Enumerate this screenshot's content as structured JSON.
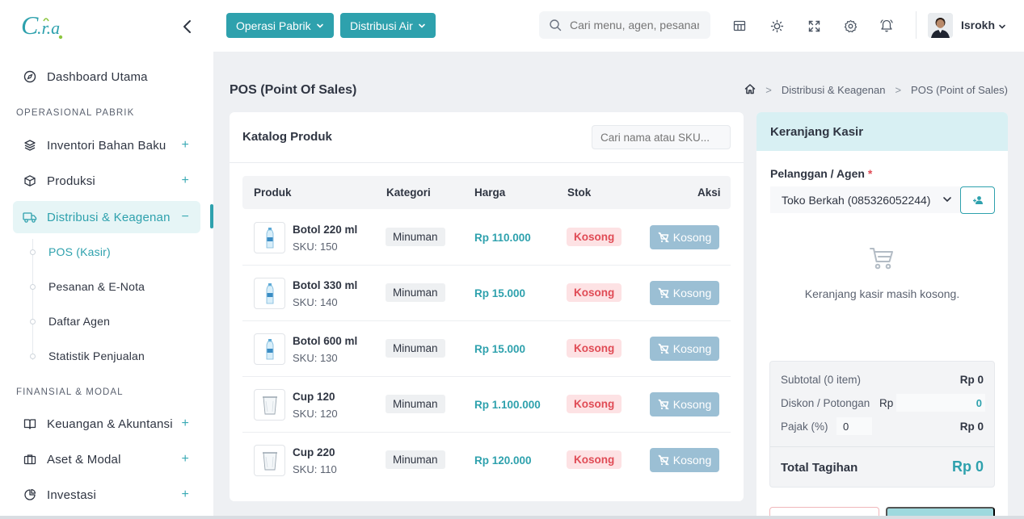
{
  "logo": {
    "text": "C.r.a."
  },
  "sidebar": {
    "dashboard": "Dashboard Utama",
    "section_operasional": "OPERASIONAL PABRIK",
    "inventori": "Inventori Bahan Baku",
    "produksi": "Produksi",
    "distribusi": "Distribusi & Keagenan",
    "sub_pos": "POS (Kasir)",
    "sub_pesanan": "Pesanan & E-Nota",
    "sub_agen": "Daftar Agen",
    "sub_statistik": "Statistik Penjualan",
    "section_finansial": "FINANSIAL & MODAL",
    "keuangan": "Keuangan & Akuntansi",
    "aset": "Aset & Modal",
    "investasi": "Investasi",
    "plus": "+",
    "minus": "−"
  },
  "topbar": {
    "btn_operasi": "Operasi Pabrik",
    "btn_distribusi": "Distribusi Air",
    "search_placeholder": "Cari menu, agen, pesanan...",
    "user_name": "Isrokh"
  },
  "page": {
    "title": "POS (Point Of Sales)",
    "breadcrumb_1": "Distribusi & Keagenan",
    "breadcrumb_2": "POS (Point of Sales)",
    "breadcrumb_sep": ">"
  },
  "catalog": {
    "title": "Katalog Produk",
    "search_placeholder": "Cari nama atau SKU...",
    "headers": {
      "produk": "Produk",
      "kategori": "Kategori",
      "harga": "Harga",
      "stok": "Stok",
      "aksi": "Aksi"
    },
    "rows": [
      {
        "name": "Botol 220 ml",
        "sku": "SKU: 150",
        "category": "Minuman",
        "price": "Rp 110.000",
        "stock": "Kosong",
        "action": "Kosong"
      },
      {
        "name": "Botol 330 ml",
        "sku": "SKU: 140",
        "category": "Minuman",
        "price": "Rp 15.000",
        "stock": "Kosong",
        "action": "Kosong"
      },
      {
        "name": "Botol 600 ml",
        "sku": "SKU: 130",
        "category": "Minuman",
        "price": "Rp 15.000",
        "stock": "Kosong",
        "action": "Kosong"
      },
      {
        "name": "Cup 120",
        "sku": "SKU: 120",
        "category": "Minuman",
        "price": "Rp 1.100.000",
        "stock": "Kosong",
        "action": "Kosong"
      },
      {
        "name": "Cup 220",
        "sku": "SKU: 110",
        "category": "Minuman",
        "price": "Rp 120.000",
        "stock": "Kosong",
        "action": "Kosong"
      }
    ]
  },
  "cart": {
    "title": "Keranjang Kasir",
    "customer_label": "Pelanggan / Agen",
    "required_mark": "*",
    "customer_value": "Toko Berkah (085326052244)",
    "empty_text": "Keranjang kasir masih kosong.",
    "subtotal_label": "Subtotal (0 item)",
    "subtotal_value": "Rp 0",
    "diskon_label": "Diskon / Potongan",
    "diskon_prefix": "Rp",
    "diskon_value": "0",
    "pajak_label": "Pajak (%)",
    "pajak_value": "0",
    "pajak_amount": "Rp 0",
    "total_label": "Total Tagihan",
    "total_value": "Rp 0"
  },
  "colors": {
    "accent": "#2ea1ad",
    "danger": "#e04b55",
    "disabled_button": "#9bbfd4",
    "cart_header": "#d8f0f3"
  }
}
